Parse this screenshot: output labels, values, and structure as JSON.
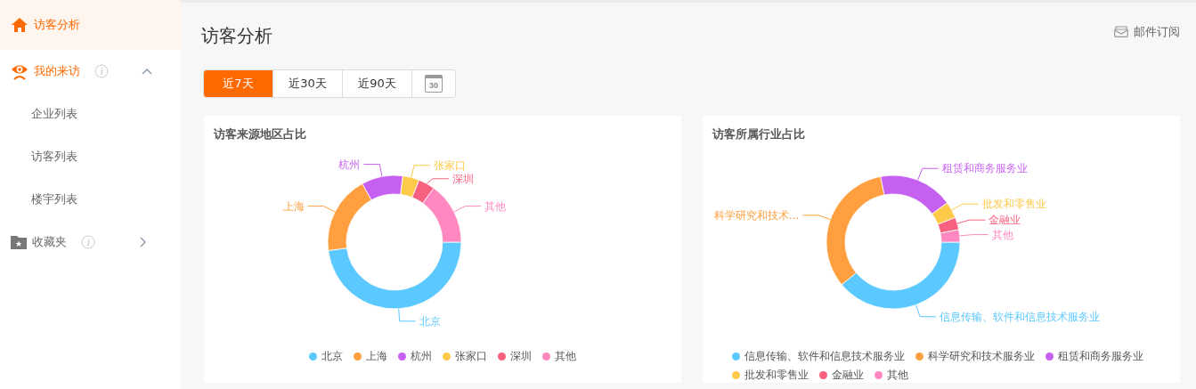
{
  "sidebar": {
    "items": [
      {
        "kind": "link",
        "label": "访客分析",
        "selected": true
      },
      {
        "kind": "group",
        "label": "我的来访",
        "selected": false,
        "expanded": true,
        "children": [
          {
            "label": "企业列表",
            "selected": false
          },
          {
            "label": "访客列表",
            "selected": false
          },
          {
            "label": "楼宇列表",
            "selected": false
          }
        ]
      },
      {
        "kind": "group",
        "label": "收藏夹",
        "selected": false,
        "expanded": false
      }
    ]
  },
  "header": {
    "title": "访客分析",
    "subscribe": "邮件订阅"
  },
  "range_tabs": [
    {
      "label": "近7天",
      "selected": true
    },
    {
      "label": "近30天",
      "selected": false
    },
    {
      "label": "近90天",
      "selected": false
    }
  ],
  "calendar_button": {
    "day": "30"
  },
  "charts": [
    {
      "chart_data": {
        "type": "donut",
        "title": "访客来源地区占比",
        "categories": [
          "北京",
          "上海",
          "杭州",
          "张家口",
          "深圳",
          "其他"
        ],
        "values": [
          48,
          19,
          10,
          4,
          4,
          15
        ],
        "colors": [
          "#5bc8ff",
          "#ff9f3f",
          "#c660f0",
          "#ffc94a",
          "#f7607e",
          "#ff88c0"
        ]
      },
      "callouts": [
        "北京",
        "上海",
        "杭州",
        "张家口",
        "深圳",
        "其他"
      ]
    },
    {
      "chart_data": {
        "type": "donut",
        "title": "访客所属行业占比",
        "categories": [
          "信息传输、软件和信息技术服务业",
          "科学研究和技术服务业",
          "租赁和商务服务业",
          "批发和零售业",
          "金融业",
          "其他"
        ],
        "values": [
          39,
          33,
          18,
          4,
          3,
          3
        ],
        "colors": [
          "#5bc8ff",
          "#ff9f3f",
          "#c660f0",
          "#ffc94a",
          "#f7607e",
          "#ff88c0"
        ]
      },
      "callouts": [
        "信息传输、软件和信息技术服务业",
        "科学研究和技术...",
        "租赁和商务服务业",
        "批发和零售业",
        "金融业",
        "其他"
      ]
    }
  ]
}
